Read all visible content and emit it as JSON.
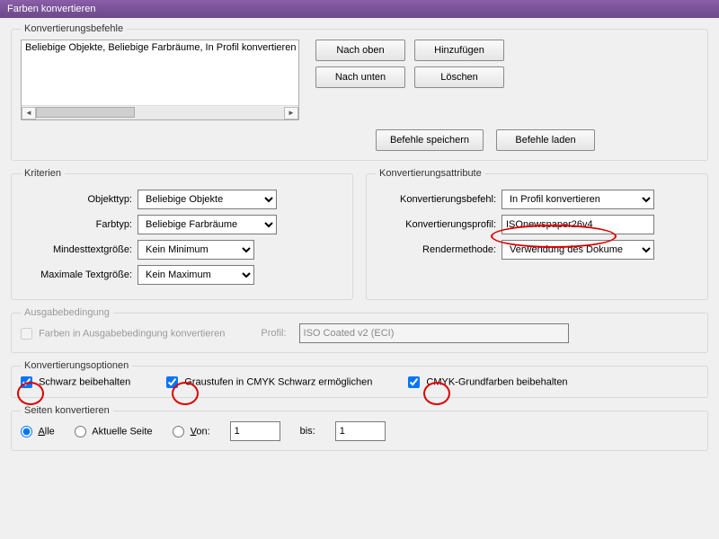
{
  "title": "Farben konvertieren",
  "commands": {
    "legend": "Konvertierungsbefehle",
    "list_item": "Beliebige Objekte, Beliebige Farbräume, In Profil konvertieren",
    "move_up": "Nach oben",
    "add": "Hinzufügen",
    "move_down": "Nach unten",
    "delete": "Löschen",
    "save": "Befehle speichern",
    "load": "Befehle laden"
  },
  "criteria": {
    "legend": "Kriterien",
    "object_type_label": "Objekttyp:",
    "object_type_value": "Beliebige Objekte",
    "color_type_label": "Farbtyp:",
    "color_type_value": "Beliebige Farbräume",
    "min_text_label": "Mindesttextgröße:",
    "min_text_value": "Kein Minimum",
    "max_text_label": "Maximale Textgröße:",
    "max_text_value": "Kein Maximum"
  },
  "attributes": {
    "legend": "Konvertierungsattribute",
    "command_label": "Konvertierungsbefehl:",
    "command_value": "In Profil konvertieren",
    "profile_label": "Konvertierungsprofil:",
    "profile_value": "ISOnewspaper26v4",
    "render_label": "Rendermethode:",
    "render_value": "Verwendung des Dokuments"
  },
  "output": {
    "legend": "Ausgabebedingung",
    "convert_label": "Farben in Ausgabebedingung konvertieren",
    "profile_label": "Profil:",
    "profile_value": "ISO Coated v2 (ECI)"
  },
  "options": {
    "legend": "Konvertierungsoptionen",
    "preserve_black": "Schwarz beibehalten",
    "gray_to_cmyk": "Graustufen in CMYK Schwarz ermöglichen",
    "preserve_cmyk": "CMYK-Grundfarben beibehalten"
  },
  "pages": {
    "legend": "Seiten konvertieren",
    "all_prefix": "A",
    "all_rest": "lle",
    "current": "Aktuelle Seite",
    "from_prefix": "V",
    "from_rest": "on:",
    "from_value": "1",
    "to_label": "bis:",
    "to_value": "1"
  }
}
